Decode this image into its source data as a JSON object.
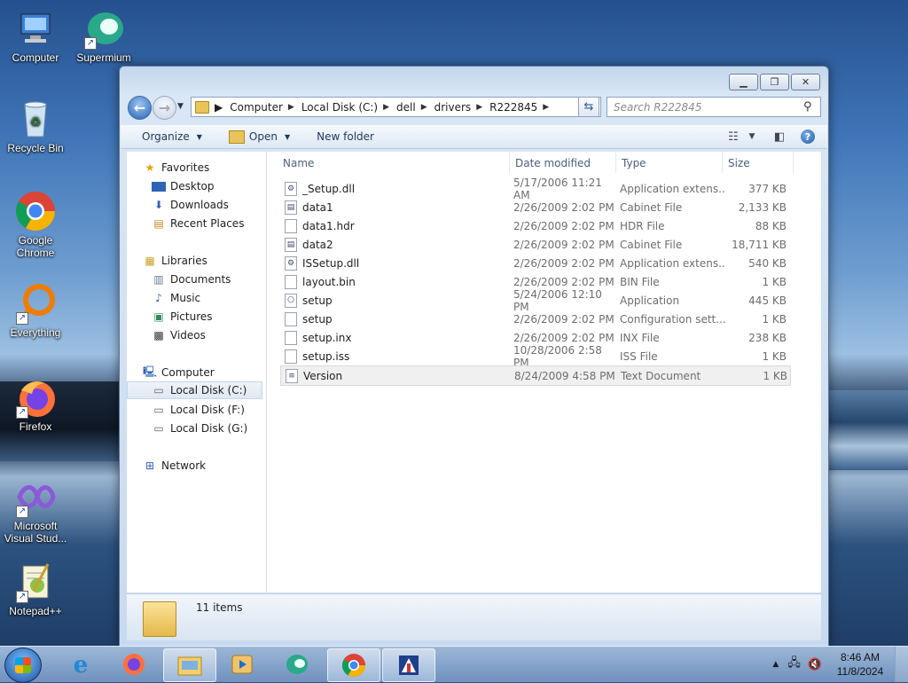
{
  "desktop": {
    "icons": [
      {
        "label": "Computer",
        "icon": "computer-icon"
      },
      {
        "label": "Supermium",
        "icon": "supermium-icon"
      },
      {
        "label": "Recycle Bin",
        "icon": "recycle-bin-icon"
      },
      {
        "label": "Google Chrome",
        "icon": "chrome-icon"
      },
      {
        "label": "Everything",
        "icon": "everything-icon"
      },
      {
        "label": "Firefox",
        "icon": "firefox-icon"
      },
      {
        "label": "Microsoft Visual Stud...",
        "icon": "visual-studio-icon"
      },
      {
        "label": "Notepad++",
        "icon": "notepadpp-icon"
      }
    ]
  },
  "window": {
    "address": {
      "crumbs": [
        "Computer",
        "Local Disk (C:)",
        "dell",
        "drivers",
        "R222845"
      ]
    },
    "search": {
      "placeholder": "Search R222845"
    },
    "toolbar": {
      "organize": "Organize",
      "open": "Open",
      "new_folder": "New folder"
    },
    "nav": {
      "favorites": "Favorites",
      "desktop": "Desktop",
      "downloads": "Downloads",
      "recent_places": "Recent Places",
      "libraries": "Libraries",
      "documents": "Documents",
      "music": "Music",
      "pictures": "Pictures",
      "videos": "Videos",
      "computer": "Computer",
      "local_c": "Local Disk (C:)",
      "local_f": "Local Disk (F:)",
      "local_g": "Local Disk (G:)",
      "network": "Network"
    },
    "columns": {
      "name": "Name",
      "date": "Date modified",
      "type": "Type",
      "size": "Size"
    },
    "files": [
      {
        "name": "_Setup.dll",
        "date": "5/17/2006 11:21 AM",
        "type": "Application extens...",
        "size": "377 KB"
      },
      {
        "name": "data1",
        "date": "2/26/2009 2:02 PM",
        "type": "Cabinet File",
        "size": "2,133 KB"
      },
      {
        "name": "data1.hdr",
        "date": "2/26/2009 2:02 PM",
        "type": "HDR File",
        "size": "88 KB"
      },
      {
        "name": "data2",
        "date": "2/26/2009 2:02 PM",
        "type": "Cabinet File",
        "size": "18,711 KB"
      },
      {
        "name": "ISSetup.dll",
        "date": "2/26/2009 2:02 PM",
        "type": "Application extens...",
        "size": "540 KB"
      },
      {
        "name": "layout.bin",
        "date": "2/26/2009 2:02 PM",
        "type": "BIN File",
        "size": "1 KB"
      },
      {
        "name": "setup",
        "date": "5/24/2006 12:10 PM",
        "type": "Application",
        "size": "445 KB"
      },
      {
        "name": "setup",
        "date": "2/26/2009 2:02 PM",
        "type": "Configuration sett...",
        "size": "1 KB"
      },
      {
        "name": "setup.inx",
        "date": "2/26/2009 2:02 PM",
        "type": "INX File",
        "size": "238 KB"
      },
      {
        "name": "setup.iss",
        "date": "10/28/2006 2:58 PM",
        "type": "ISS File",
        "size": "1 KB"
      },
      {
        "name": "Version",
        "date": "8/24/2009 4:58 PM",
        "type": "Text Document",
        "size": "1 KB"
      }
    ],
    "status": {
      "items_count": "11 items"
    }
  },
  "taskbar": {
    "pinned": [
      "internet-explorer-icon",
      "firefox-icon",
      "explorer-icon",
      "media-player-icon",
      "supermium-icon",
      "chrome-icon",
      "app-icon"
    ],
    "clock": {
      "time": "8:46 AM",
      "date": "11/8/2024"
    }
  }
}
